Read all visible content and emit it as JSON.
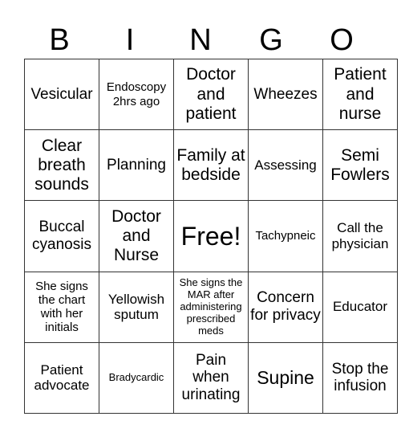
{
  "header": {
    "letters": [
      "B",
      "I",
      "N",
      "G",
      "O"
    ]
  },
  "grid": {
    "rows": [
      [
        "Vesicular",
        "Endoscopy 2hrs ago",
        "Doctor and patient",
        "Wheezes",
        "Patient and nurse"
      ],
      [
        "Clear breath sounds",
        "Planning",
        "Family at bedside",
        "Assessing",
        "Semi Fowlers"
      ],
      [
        "Buccal cyanosis",
        "Doctor and Nurse",
        "Free!",
        "Tachypneic",
        "Call the physician"
      ],
      [
        "She signs the chart with her initials",
        "Yellowish sputum",
        "She signs the MAR after administering prescribed meds",
        "Concern for privacy",
        "Educator"
      ],
      [
        "Patient advocate",
        "Bradycardic",
        "Pain when urinating",
        "Supine",
        "Stop the infusion"
      ]
    ]
  }
}
